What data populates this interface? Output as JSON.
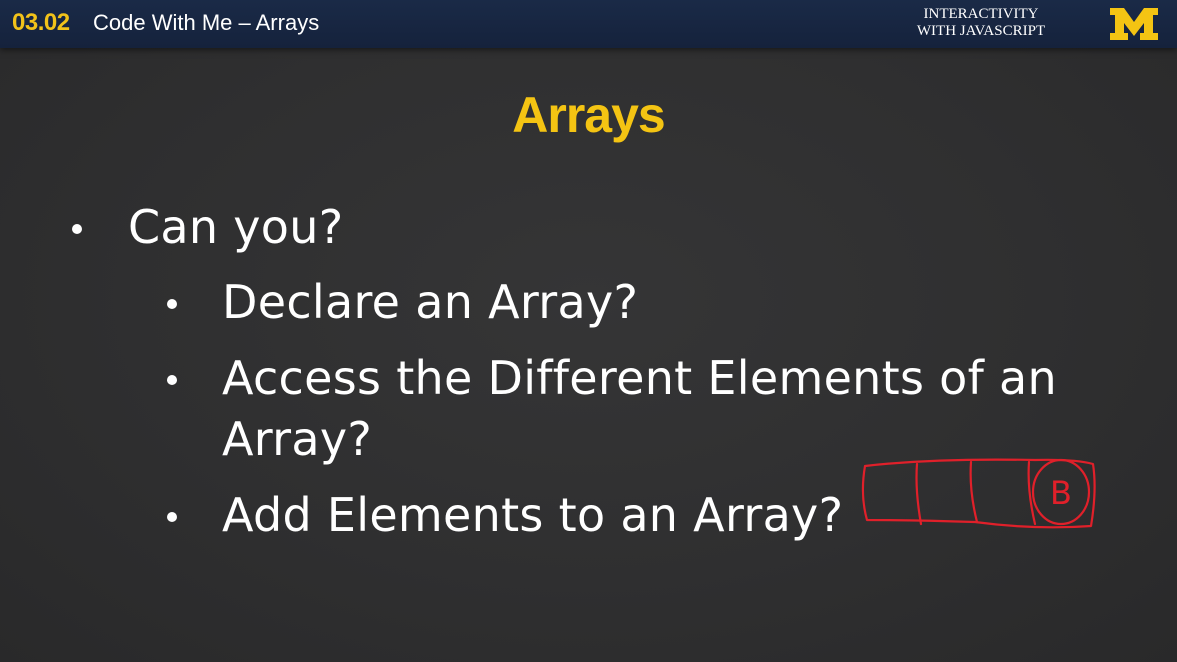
{
  "header": {
    "lesson_number": "03.02",
    "lesson_title": "Code With Me – Arrays",
    "course_line1": "INTERACTIVITY",
    "course_line2": "WITH JAVASCRIPT",
    "logo_letter": "M"
  },
  "slide": {
    "title": "Arrays",
    "question": "Can you?",
    "items": [
      "Declare an Array?",
      "Access the Different Elements of an",
      "Array?",
      "Add Elements to an Array?"
    ],
    "annotation_letter": "B"
  },
  "colors": {
    "title": "#f4c413",
    "lesson_number": "#f2c31a",
    "header_bg": "#15223c",
    "slide_bg": "#2f2f30",
    "annotation": "#e0202a"
  }
}
